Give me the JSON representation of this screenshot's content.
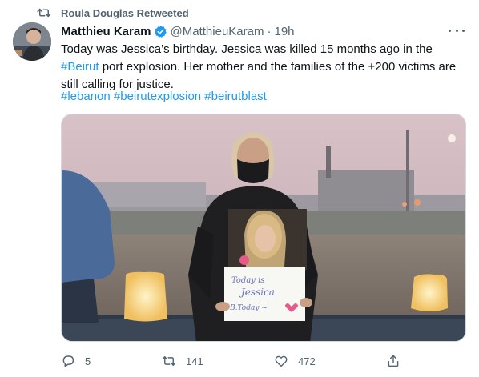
{
  "retweet": {
    "icon": "retweet-icon",
    "label": "Roula Douglas Retweeted"
  },
  "tweet": {
    "author_name": "Matthieu Karam",
    "verified_icon": "verified-badge-icon",
    "handle": "@MatthieuKaram",
    "separator": "·",
    "time": "19h",
    "text_part1": "Today was Jessica’s birthday. Jessica was killed 15 months ago in the ",
    "text_link": "#Beirut",
    "text_part2": " port explosion. Her mother and the families of the +200 victims are still calling for justice.",
    "hashtags": "#lebanon #beirutexplosion #beirutblast",
    "media": {
      "sign_lines": [
        "Today is",
        "Jessica",
        "B.Today ~"
      ]
    }
  },
  "actions": {
    "reply_count": "5",
    "retweet_count": "141",
    "like_count": "472"
  },
  "colors": {
    "link": "#1d9bf0",
    "secondary_text": "#536471",
    "primary_text": "#0f1419"
  }
}
